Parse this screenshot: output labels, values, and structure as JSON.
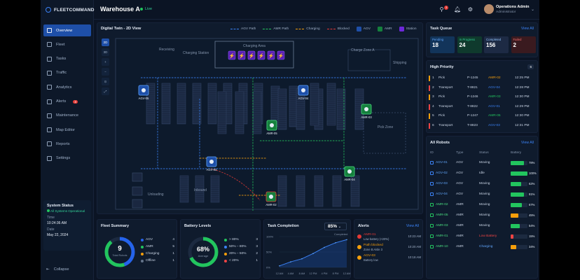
{
  "brand": {
    "name": "FLEETCOMMAND"
  },
  "nav": [
    {
      "label": "Overview",
      "active": true
    },
    {
      "label": "Fleet"
    },
    {
      "label": "Tasks"
    },
    {
      "label": "Traffic"
    },
    {
      "label": "Analytics"
    },
    {
      "label": "Alerts",
      "badge": "3"
    },
    {
      "label": "Maintenance"
    },
    {
      "label": "Map Editor"
    },
    {
      "label": "Reports"
    },
    {
      "label": "Settings"
    }
  ],
  "system_status": {
    "title": "System Status",
    "status": "All Systems Operational",
    "time_label": "Time",
    "time": "10:24:36 AM",
    "date_label": "Date",
    "date": "May 22, 2024"
  },
  "collapse_label": "Collapse",
  "header": {
    "warehouse": "Warehouse A",
    "live": "Live",
    "notif_count": "3",
    "user_name": "Operations Admin",
    "user_role": "Administrator"
  },
  "map": {
    "title": "Digital Twin - 2D View",
    "legend": {
      "agv_path": "AGV Path",
      "amr_path": "AMR Path",
      "charging": "Charging",
      "blocked": "Blocked",
      "agv": "AGV",
      "amr": "AMR",
      "station": "Station"
    },
    "tools": [
      "2D",
      "3D",
      "+",
      "−",
      "⊙",
      "⤢"
    ],
    "zones": {
      "receiving": "Receiving",
      "charging_station": "Charging Station",
      "charging_area": "Charging Area",
      "charge_a": "Charge Zone A",
      "pick_zone": "Pick Zone",
      "shipping": "Shipping",
      "unloading": "Unloading",
      "inbound": "Inbound"
    },
    "robots": [
      {
        "id": "AGV-05",
        "kind": "agv"
      },
      {
        "id": "AGV-04",
        "kind": "agv"
      },
      {
        "id": "AGV-03",
        "kind": "agv"
      },
      {
        "id": "AMR-05",
        "kind": "amr"
      },
      {
        "id": "AMR-03",
        "kind": "amr"
      },
      {
        "id": "AMR-04",
        "kind": "amr"
      },
      {
        "id": "AMR-02",
        "kind": "amr_alert"
      }
    ]
  },
  "task_queue": {
    "title": "Task Queue",
    "view_all": "View All",
    "stats": [
      {
        "label": "Pending",
        "value": "18"
      },
      {
        "label": "In Progress",
        "value": "24"
      },
      {
        "label": "Completed",
        "value": "156"
      },
      {
        "label": "Failed",
        "value": "2"
      }
    ]
  },
  "high_priority": {
    "title": "High Priority",
    "count": "6",
    "rows": [
      {
        "n": "1",
        "type": "Pick",
        "id": "P-1245",
        "robot": "AMR-02",
        "time": "12:25 PM"
      },
      {
        "n": "2",
        "type": "Transport",
        "id": "T-8821",
        "robot": "AGV-04",
        "time": "12:28 PM"
      },
      {
        "n": "3",
        "type": "Pick",
        "id": "P-1246",
        "robot": "AMR-03",
        "time": "12:30 PM"
      },
      {
        "n": "4",
        "type": "Transport",
        "id": "T-8822",
        "robot": "AGV-01",
        "time": "12:29 PM"
      },
      {
        "n": "5",
        "type": "Pick",
        "id": "P-1247",
        "robot": "AMR-05",
        "time": "12:30 PM"
      },
      {
        "n": "6",
        "type": "Transport",
        "id": "T-8823",
        "robot": "AGV-03",
        "time": "12:31 PM"
      }
    ]
  },
  "all_robots": {
    "title": "All Robots",
    "view_all": "View All",
    "headers": [
      "ID",
      "Type",
      "Status",
      "Battery"
    ],
    "rows": [
      {
        "id": "AGV-01",
        "type": "AGV",
        "status": "Moving",
        "battery": "78%",
        "b": 0.78
      },
      {
        "id": "AGV-02",
        "type": "AGV",
        "status": "Idle",
        "battery": "100%",
        "b": 1.0
      },
      {
        "id": "AGV-03",
        "type": "AGV",
        "status": "Moving",
        "battery": "62%",
        "b": 0.62
      },
      {
        "id": "AGV-04",
        "type": "AGV",
        "status": "Moving",
        "battery": "81%",
        "b": 0.81
      },
      {
        "id": "AMR-02",
        "type": "AMR",
        "status": "Moving",
        "battery": "67%",
        "b": 0.67
      },
      {
        "id": "AMR-05",
        "type": "AMR",
        "status": "Moving",
        "battery": "45%",
        "b": 0.45
      },
      {
        "id": "AMR-03",
        "type": "AMR",
        "status": "Moving",
        "battery": "54%",
        "b": 0.54
      },
      {
        "id": "AMR-01",
        "type": "AMR",
        "status": "Low Battery",
        "battery": "15%",
        "b": 0.15
      },
      {
        "id": "AMR-10",
        "type": "AMR",
        "status": "Charging",
        "battery": "34%",
        "b": 0.34
      }
    ]
  },
  "fleet_summary": {
    "title": "Fleet Summary",
    "total": "9",
    "total_label": "Total Robots",
    "items": [
      {
        "label": "AGV",
        "value": "4"
      },
      {
        "label": "AMR",
        "value": "5"
      },
      {
        "label": "Charging",
        "value": "1"
      },
      {
        "label": "Offline",
        "value": "1"
      }
    ]
  },
  "battery_levels": {
    "title": "Battery Levels",
    "avg": "68%",
    "avg_label": "Average",
    "items": [
      {
        "label": "> 80%",
        "value": "3"
      },
      {
        "label": "50% – 80%",
        "value": "3"
      },
      {
        "label": "20% – 50%",
        "value": "2"
      },
      {
        "label": "< 20%",
        "value": "1"
      }
    ]
  },
  "task_completion": {
    "title": "Task Completion",
    "value": "85%",
    "series_label": "Completed",
    "chart_data": {
      "type": "area",
      "x": [
        "12 AM",
        "4 AM",
        "8 AM",
        "12 PM",
        "4 PM",
        "8 PM",
        "12 AM"
      ],
      "values": [
        5,
        18,
        28,
        45,
        65,
        80,
        90
      ],
      "ylim": [
        0,
        100
      ],
      "yticks": [
        "100%",
        "50%",
        "0%"
      ]
    }
  },
  "alerts": {
    "title": "Alerts",
    "view_all": "View All",
    "rows": [
      {
        "title": "AMR-01",
        "desc": "Low battery (<20%)",
        "time": "10:23 AM",
        "color": "#e53935"
      },
      {
        "title": "Path blocked",
        "desc": "Zone B Aisle 3",
        "time": "10:20 AM",
        "color": "#f59e0b"
      },
      {
        "title": "AGV-03",
        "desc": "Battery low",
        "time": "10:18 AM",
        "color": "#f59e0b"
      }
    ]
  }
}
